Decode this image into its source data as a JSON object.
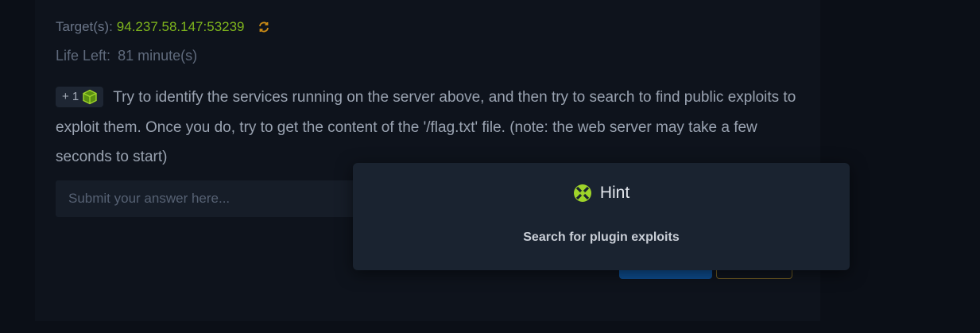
{
  "target": {
    "label": "Target(s):",
    "value": "94.237.58.147:53239"
  },
  "life": {
    "label": "Life Left:",
    "value": "81 minute(s)"
  },
  "question": {
    "badge": "+ 1",
    "text": "Try to identify the services running on the server above, and then try to search to find public exploits to exploit them. Once you do, try to get the content of the '/flag.txt' file. (note: the web server may take a few seconds to start)"
  },
  "answer": {
    "placeholder": "Submit your answer here..."
  },
  "hint_modal": {
    "title": "Hint",
    "body": "Search for plugin exploits"
  },
  "colors": {
    "accent_green": "#7fb51d",
    "submit_blue": "#0d4a8a",
    "hint_border": "#6b5820"
  },
  "icons": {
    "refresh": "refresh-icon",
    "cube": "cube-icon",
    "hint_logo": "hackthebox-logo-icon"
  }
}
